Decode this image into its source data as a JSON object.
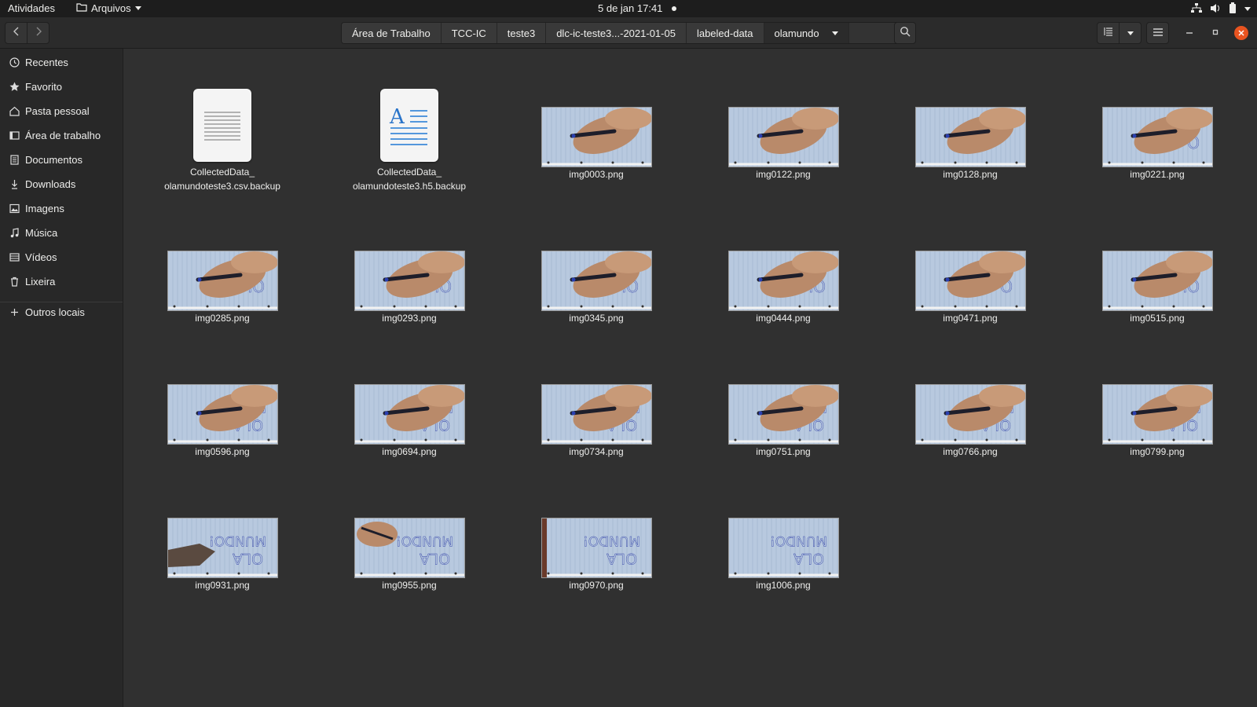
{
  "topbar": {
    "activities": "Atividades",
    "app_menu": "Arquivos",
    "clock": "5 de jan  17:41"
  },
  "headerbar": {
    "path": [
      "Área de Trabalho",
      "TCC-IC",
      "teste3",
      "dlc-ic-teste3...-2021-01-05",
      "labeled-data",
      "olamundo"
    ]
  },
  "sidebar": {
    "items": [
      {
        "label": "Recentes",
        "icon": "clock-icon"
      },
      {
        "label": "Favorito",
        "icon": "star-icon"
      },
      {
        "label": "Pasta pessoal",
        "icon": "home-icon"
      },
      {
        "label": "Área de trabalho",
        "icon": "desktop-icon"
      },
      {
        "label": "Documentos",
        "icon": "document-icon"
      },
      {
        "label": "Downloads",
        "icon": "download-icon"
      },
      {
        "label": "Imagens",
        "icon": "image-icon"
      },
      {
        "label": "Música",
        "icon": "music-icon"
      },
      {
        "label": "Vídeos",
        "icon": "video-icon"
      },
      {
        "label": "Lixeira",
        "icon": "trash-icon"
      }
    ],
    "other": {
      "label": "Outros locais",
      "icon": "plus-icon"
    }
  },
  "files": [
    {
      "name1": "CollectedData_",
      "name2": "olamundoteste3.csv.backup",
      "kind": "text"
    },
    {
      "name1": "CollectedData_",
      "name2": "olamundoteste3.h5.backup",
      "kind": "doc"
    },
    {
      "name1": "img0003.png",
      "kind": "image",
      "writing": ""
    },
    {
      "name1": "img0122.png",
      "kind": "image",
      "writing": ""
    },
    {
      "name1": "img0128.png",
      "kind": "image",
      "writing": ""
    },
    {
      "name1": "img0221.png",
      "kind": "image",
      "writing": "O"
    },
    {
      "name1": "img0285.png",
      "kind": "image",
      "writing": "OL"
    },
    {
      "name1": "img0293.png",
      "kind": "image",
      "writing": "OL"
    },
    {
      "name1": "img0345.png",
      "kind": "image",
      "writing": "OL"
    },
    {
      "name1": "img0444.png",
      "kind": "image",
      "writing": "OLA"
    },
    {
      "name1": "img0471.png",
      "kind": "image",
      "writing": "O"
    },
    {
      "name1": "img0515.png",
      "kind": "image",
      "writing": "OLA"
    },
    {
      "name1": "img0596.png",
      "kind": "image",
      "writing": "OLA M"
    },
    {
      "name1": "img0694.png",
      "kind": "image",
      "writing": "OLA MU"
    },
    {
      "name1": "img0734.png",
      "kind": "image",
      "writing": "OLA MUN"
    },
    {
      "name1": "img0751.png",
      "kind": "image",
      "writing": "OLA MUN"
    },
    {
      "name1": "img0766.png",
      "kind": "image",
      "writing": "OLA MUN"
    },
    {
      "name1": "img0799.png",
      "kind": "image",
      "writing": "OLA MUND"
    },
    {
      "name1": "img0931.png",
      "kind": "image",
      "writing": "OLA MUNDO!"
    },
    {
      "name1": "img0955.png",
      "kind": "image",
      "writing": "OLA MUNDO!"
    },
    {
      "name1": "img0970.png",
      "kind": "image",
      "writing": "OLA MUNDO!"
    },
    {
      "name1": "img1006.png",
      "kind": "image",
      "writing": "OLA MUNDO!"
    }
  ],
  "colors": {
    "accent": "#e95420",
    "paper": "#b8c9df",
    "ink": "#2f3fa8",
    "skin": "#b98a6a"
  }
}
